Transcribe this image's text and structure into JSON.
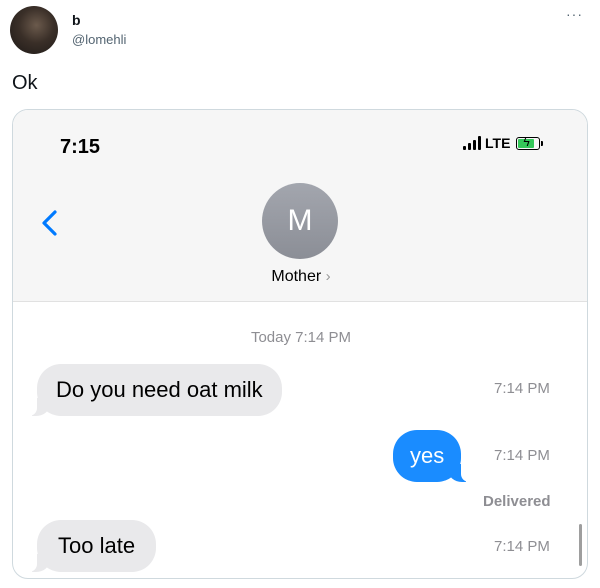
{
  "tweet": {
    "author_name": "b",
    "author_handle": "@lomehli",
    "more_label": "···",
    "text": "Ok"
  },
  "phone": {
    "status_bar": {
      "time": "7:15",
      "network": "LTE",
      "battery_charging": true
    },
    "contact": {
      "initial": "M",
      "name": "Mother",
      "chevron": "›"
    },
    "day_stamp": "Today 7:14 PM",
    "messages": [
      {
        "text": "Do you need oat milk",
        "direction": "incoming",
        "time": "7:14 PM"
      },
      {
        "text": "yes",
        "direction": "outgoing",
        "time": "7:14 PM",
        "status": "Delivered"
      },
      {
        "text": "Too late",
        "direction": "incoming",
        "time": "7:14 PM"
      }
    ],
    "colors": {
      "outgoing_bubble": "#1a8cff",
      "incoming_bubble": "#e9e9eb",
      "accent": "#007aff",
      "battery": "#34c759"
    },
    "icons": [
      "back-chevron-icon",
      "signal-bars-icon",
      "battery-charging-icon"
    ]
  }
}
